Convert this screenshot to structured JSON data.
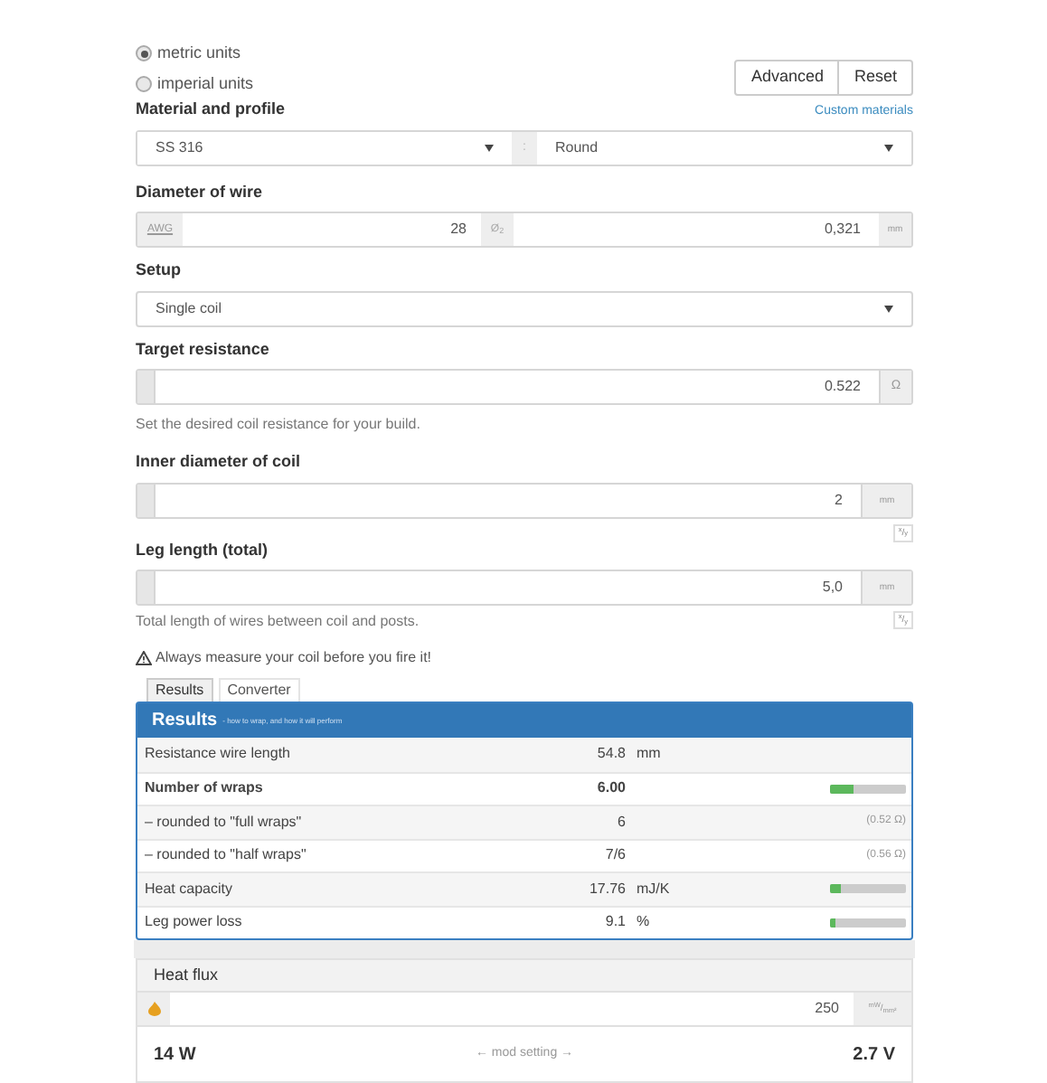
{
  "units": [
    {
      "label": "metric units",
      "selected": true
    },
    {
      "label": "imperial units",
      "selected": false
    }
  ],
  "buttons": [
    "Advanced",
    "Reset"
  ],
  "material": {
    "label": "Material and profile",
    "link": "Custom materials",
    "material": "SS 316",
    "separator": ":",
    "profile": "Round"
  },
  "diameter": {
    "label": "Diameter of wire",
    "gauge_unit": "AWG",
    "gauge": "28",
    "diameter_prefix": "Ø$_{2}$",
    "diameter": "0,321",
    "unit": "mm"
  },
  "setup": {
    "label": "Setup",
    "value": "Single coil"
  },
  "target_resistance": {
    "label": "Target resistance",
    "value": "0.522",
    "unit": "Ω",
    "help": "Set the desired coil resistance for your build."
  },
  "inner_diameter": {
    "label": "Inner diameter of coil",
    "value": "2",
    "unit": "mm",
    "swap": "$^{x}$/$_{y}$"
  },
  "leg_length": {
    "label": "Leg length (total)",
    "value": "5,0",
    "unit": "mm",
    "swap": "$^{x}$/$_{y}$",
    "help": "Total length of wires between coil and posts."
  },
  "warning": "Always measure your coil before you fire it!",
  "tabs": [
    {
      "label": "Results",
      "selected": true
    },
    {
      "label": "Converter",
      "selected": false
    }
  ],
  "results": {
    "title": "Results",
    "subtitle": "- how to wrap, and how it will perform",
    "rows": [
      {
        "label": "Resistance wire length",
        "value": "54.8",
        "unit": "mm",
        "bold": false
      },
      {
        "label": "Number of wraps",
        "value": "6.00",
        "bold": true,
        "level": 0.3
      },
      {
        "label": "– rounded to \"full wraps\"",
        "value": "6",
        "note": "(0.52 Ω)",
        "bold": false
      },
      {
        "label": "– rounded to \"half wraps\"",
        "value": "7/6",
        "note": "(0.56 Ω)",
        "bold": false
      },
      {
        "label": "Heat capacity",
        "value": "17.76",
        "unit": "mJ/K",
        "bold": false,
        "level": 0.15
      },
      {
        "label": "Leg power loss",
        "value": "9.1",
        "unit": "%",
        "bold": false,
        "level": 0.06
      }
    ]
  },
  "heat_flux": {
    "title": "Heat flux",
    "value": "250",
    "unit": "$^{mW}$/$_{mm²}$",
    "power": "14 W",
    "hint": "← mod setting →",
    "voltage": "2.7 V"
  }
}
